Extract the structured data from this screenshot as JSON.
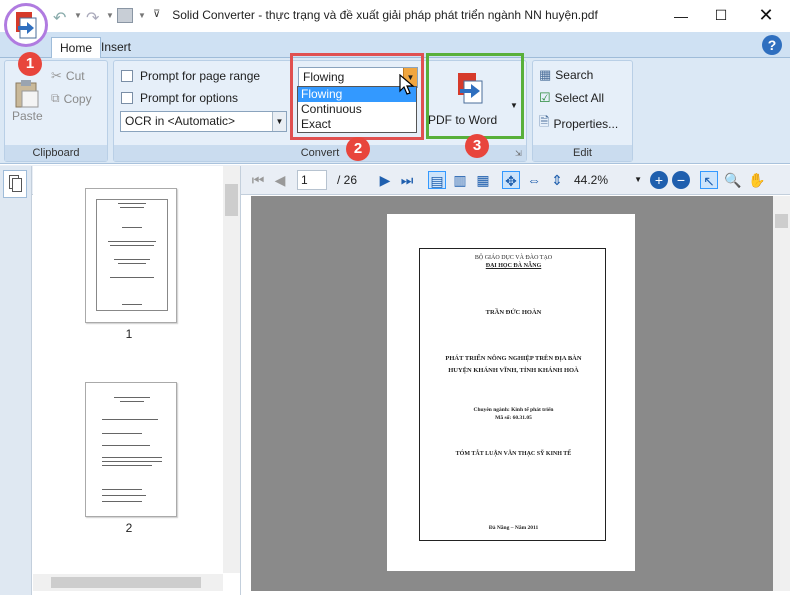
{
  "window": {
    "title": "Solid Converter - thực trạng và đề xuất giải pháp phát triển ngành NN huyện.pdf"
  },
  "tabs": [
    {
      "label": "Home"
    },
    {
      "label": "Insert"
    }
  ],
  "help": "?",
  "clipboard": {
    "paste": "Paste",
    "cut": "Cut",
    "copy": "Copy",
    "label": "Clipboard"
  },
  "convert": {
    "prompt_page_range": "Prompt for page range",
    "prompt_options": "Prompt for options",
    "ocr_value": "OCR in <Automatic>",
    "mode_value": "Flowing",
    "mode_options": [
      "Flowing",
      "Continuous",
      "Exact"
    ],
    "pdf_to_word": "PDF to Word",
    "label": "Convert"
  },
  "edit": {
    "search": "Search",
    "select_all": "Select All",
    "properties": "Properties...",
    "label": "Edit"
  },
  "badges": [
    "1",
    "2",
    "3"
  ],
  "viewbar": {
    "page": "1",
    "total": "/ 26",
    "zoom": "44.2%"
  },
  "thumbnails": [
    {
      "label": "1"
    },
    {
      "label": "2"
    }
  ],
  "document": {
    "line1": "BỘ GIÁO DỤC VÀ ĐÀO TẠO",
    "line2": "ĐẠI HỌC ĐÀ NẴNG",
    "author": "TRẦN ĐỨC HOÀN",
    "title1": "PHÁT TRIỂN NÔNG NGHIỆP TRÊN ĐỊA BÀN",
    "title2": "HUYỆN KHÁNH VĨNH, TỈNH KHÁNH HOÀ",
    "major": "Chuyên ngành: Kinh tế phát triển",
    "code": "Mã số: 60.31.05",
    "summary": "TÓM TẮT LUẬN VĂN THẠC SỸ KINH TẾ",
    "footer": "Đà Nẵng – Năm 2011"
  },
  "colors": {
    "highlight_red": "#e05050",
    "highlight_green": "#58b03a",
    "highlight_purple": "#b07be0",
    "accent_blue": "#3399ff"
  }
}
